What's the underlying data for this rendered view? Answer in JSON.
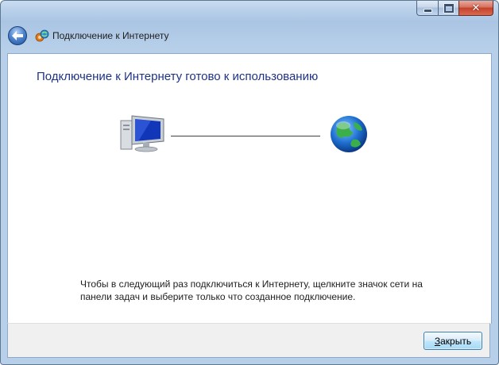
{
  "window": {
    "title": "Подключение к Интернету"
  },
  "icons": {
    "back": "back-arrow-icon",
    "network": "network-connection-icon",
    "computer": "computer-icon",
    "globe": "internet-globe-icon"
  },
  "content": {
    "heading": "Подключение к Интернету готово к использованию",
    "hint_line1": "Чтобы в следующий раз подключиться к Интернету, щелкните значок сети на",
    "hint_line2": "панели задач и выберите только что созданное подключение."
  },
  "footer": {
    "close_label_mnemonic": "З",
    "close_label_rest": "акрыть"
  },
  "colors": {
    "heading": "#1e3287",
    "frame": "#b9d0ea",
    "close_button_red": "#c4412a"
  }
}
